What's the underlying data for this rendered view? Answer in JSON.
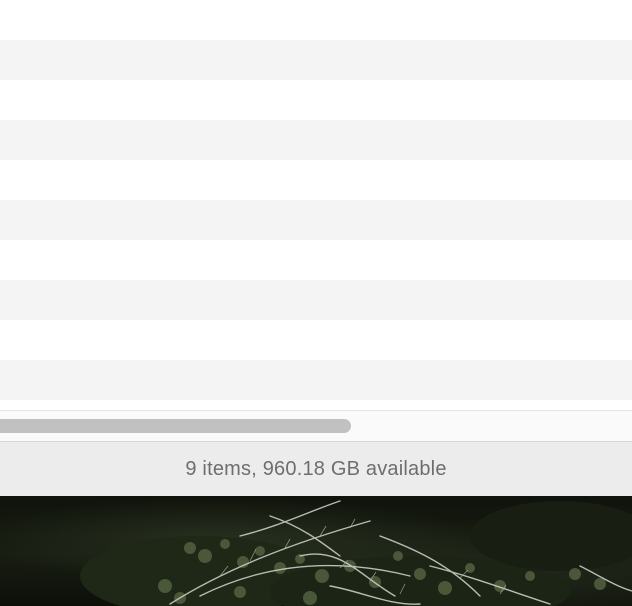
{
  "finder": {
    "rows": [
      "",
      "",
      "",
      "",
      "",
      "",
      "",
      "",
      "",
      ""
    ],
    "status": "9 items, 960.18 GB available"
  },
  "desktop": {
    "wallpaper": "dark-forest-tree-branches-photo",
    "colors": {
      "background": "#12160e",
      "foliage": "#5f6e4a",
      "branches": "#c9cdc4"
    }
  },
  "colors": {
    "row_alt": "#f4f4f4",
    "status_bg": "#ececec",
    "status_text": "#6e6e6e",
    "scroll_thumb": "#c1c1c1"
  }
}
